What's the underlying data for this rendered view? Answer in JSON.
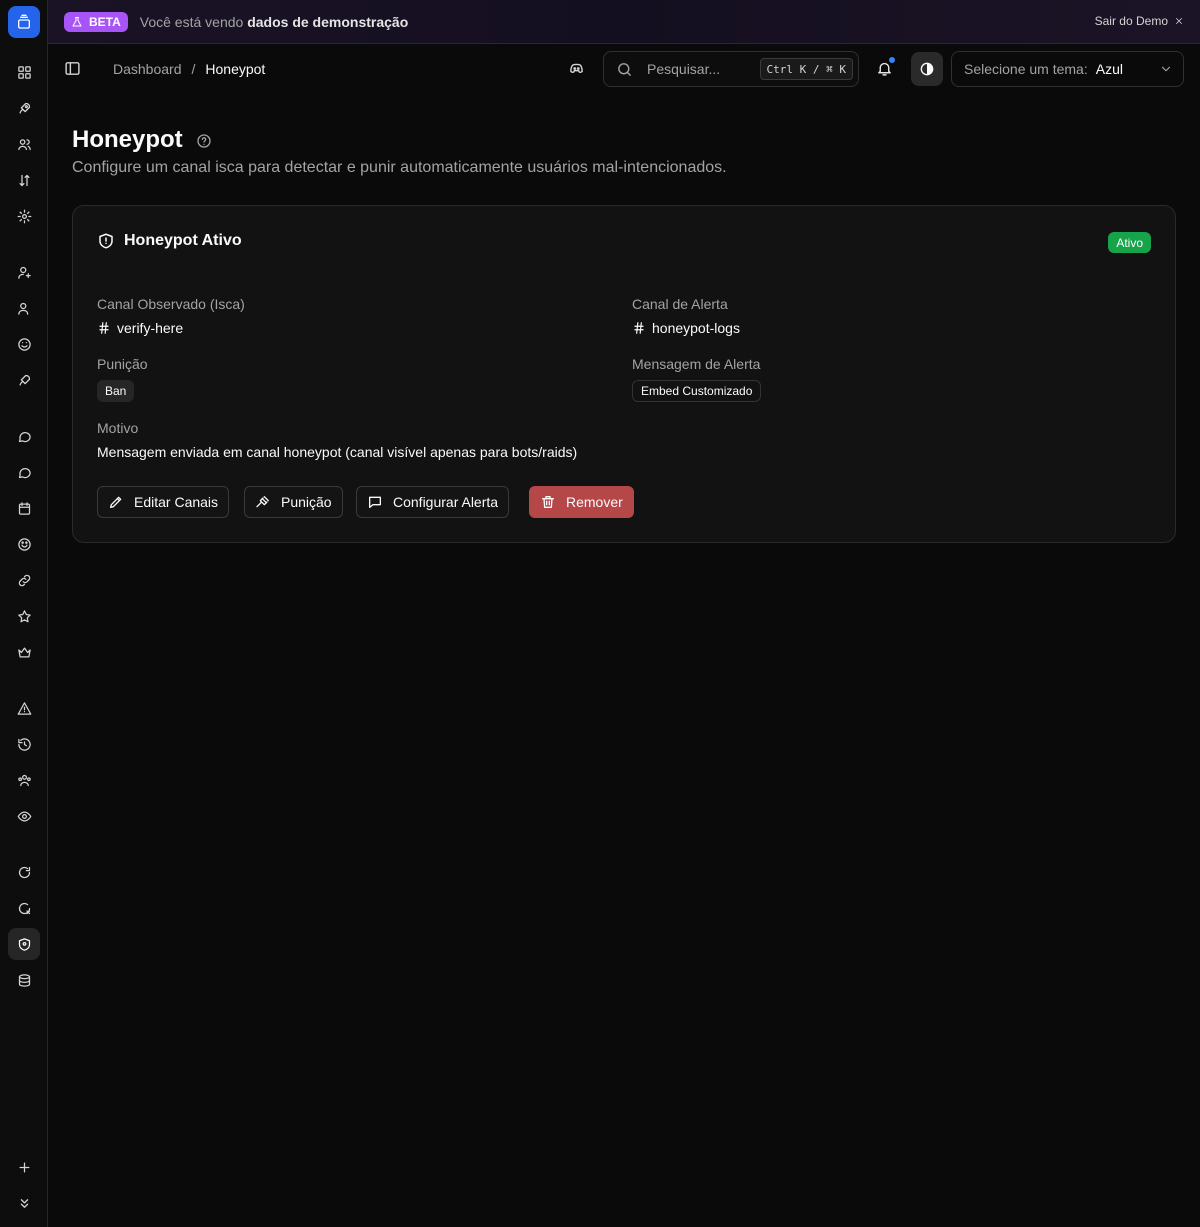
{
  "banner": {
    "badge": "BETA",
    "text_prefix": "Você está vendo",
    "text_bold": "dados de demonstração",
    "exit_label": "Sair do Demo"
  },
  "header": {
    "breadcrumb": [
      "Dashboard",
      "Honeypot"
    ],
    "search_placeholder": "Pesquisar...",
    "shortcut": "Ctrl K / ⌘ K",
    "theme_label": "Selecione um tema:",
    "theme_value": "Azul"
  },
  "page": {
    "title": "Honeypot",
    "subtitle": "Configure um canal isca para detectar e punir automaticamente usuários mal-intencionados."
  },
  "card": {
    "title": "Honeypot Ativo",
    "status": "Ativo",
    "status_color": "#16a34a",
    "fields": {
      "watched_channel_label": "Canal Observado (Isca)",
      "watched_channel": "verify-here",
      "alert_channel_label": "Canal de Alerta",
      "alert_channel": "honeypot-logs",
      "punishment_label": "Punição",
      "punishment": "Ban",
      "alert_message_label": "Mensagem de Alerta",
      "alert_message": "Embed Customizado",
      "reason_label": "Motivo",
      "reason": "Mensagem enviada em canal honeypot (canal visível apenas para bots/raids)"
    },
    "actions": {
      "edit_channels": "Editar Canais",
      "punishment": "Punição",
      "configure_alert": "Configurar Alerta",
      "remove": "Remover"
    }
  },
  "colors": {
    "accent": "#2563eb",
    "beta": "#a855f7",
    "danger": "#b54748"
  }
}
